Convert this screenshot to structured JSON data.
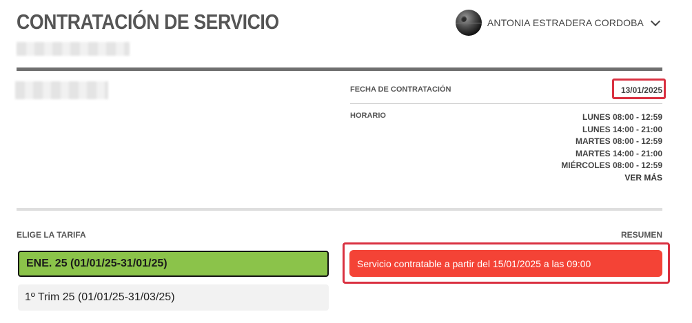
{
  "header": {
    "title": "CONTRATACIÓN DE SERVICIO",
    "user_name": "ANTONIA ESTRADERA CORDOBA",
    "user_menu_icon": "chevron-down-icon"
  },
  "details": {
    "fecha_label": "FECHA DE CONTRATACIÓN",
    "fecha_value": "13/01/2025",
    "horario_label": "HORARIO",
    "schedule": [
      "LUNES 08:00 - 12:59",
      "LUNES 14:00 - 21:00",
      "MARTES 08:00 - 12:59",
      "MARTES 14:00 - 21:00",
      "MIÉRCOLES 08:00 - 12:59"
    ],
    "ver_mas": "VER MÁS"
  },
  "tariffs": {
    "label": "ELIGE LA TARIFA",
    "items": [
      {
        "label": "ENE. 25 (01/01/25-31/01/25)",
        "selected": true
      },
      {
        "label": "1º Trim 25 (01/01/25-31/03/25)",
        "selected": false
      }
    ]
  },
  "summary": {
    "label": "RESUMEN",
    "alert": "Servicio contratable a partir del 15/01/2025 a las 09:00"
  },
  "colors": {
    "selected_tariff": "#8bc34a",
    "alert_bg": "#f44336",
    "highlight_border": "#d93040",
    "header_rule": "#6f6f6f"
  }
}
